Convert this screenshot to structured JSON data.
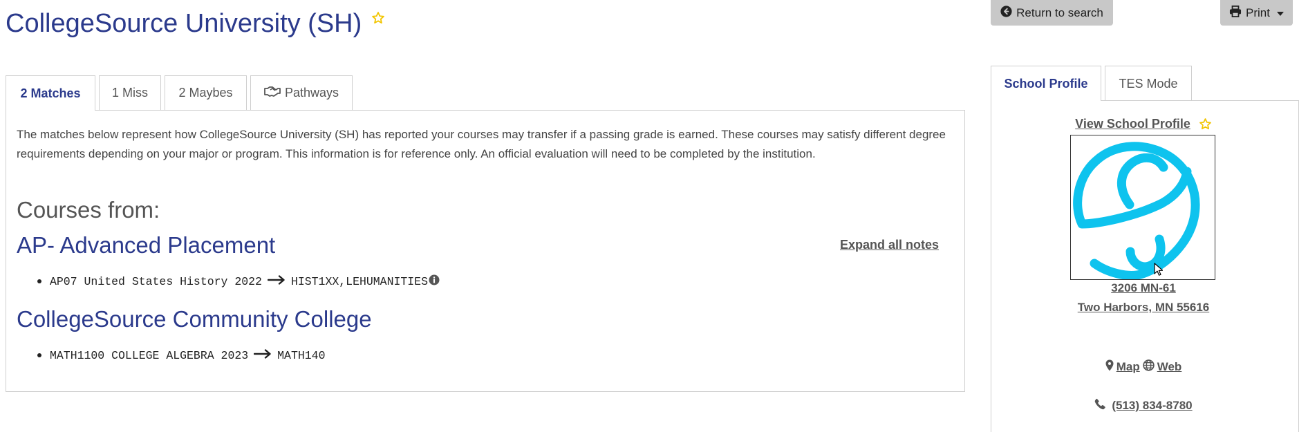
{
  "header": {
    "title": "CollegeSource University (SH)",
    "return_label": "Return to search",
    "print_label": "Print"
  },
  "tabs": [
    {
      "label": "2 Matches",
      "active": true
    },
    {
      "label": "1 Miss",
      "active": false
    },
    {
      "label": "2 Maybes",
      "active": false
    },
    {
      "label": "Pathways",
      "active": false,
      "icon": "handshake-icon"
    }
  ],
  "main": {
    "intro": "The matches below represent how CollegeSource University (SH) has reported your courses may transfer if a passing grade is earned. These courses may satisfy different degree requirements depending on your major or program. This information is for reference only. An official evaluation will need to be completed by the institution.",
    "courses_from_label": "Courses from:",
    "expand_all_label": "Expand all notes",
    "institutions": [
      {
        "name": "AP- Advanced Placement",
        "courses": [
          {
            "source": "AP07 United States History 2022",
            "target": "HIST1XX,LEHUMANITIES",
            "has_info": true
          }
        ]
      },
      {
        "name": "CollegeSource Community College",
        "courses": [
          {
            "source": "MATH1100 COLLEGE ALGEBRA 2023",
            "target": "MATH140",
            "has_info": false
          }
        ]
      }
    ]
  },
  "sidebar": {
    "tabs": [
      {
        "label": "School Profile",
        "active": true
      },
      {
        "label": "TES Mode",
        "active": false
      }
    ],
    "view_profile_label": "View School Profile",
    "address_line1": "3206 MN-61",
    "address_line2": "Two Harbors, MN 55616",
    "map_label": "Map",
    "web_label": "Web",
    "phone": "(513) 834-8780"
  },
  "colors": {
    "brand_blue": "#2b3a8c",
    "star_yellow": "#f2c500",
    "logo_cyan": "#0ec3ee",
    "button_gray": "#c8c8c8",
    "border_gray": "#cfcfcf"
  }
}
